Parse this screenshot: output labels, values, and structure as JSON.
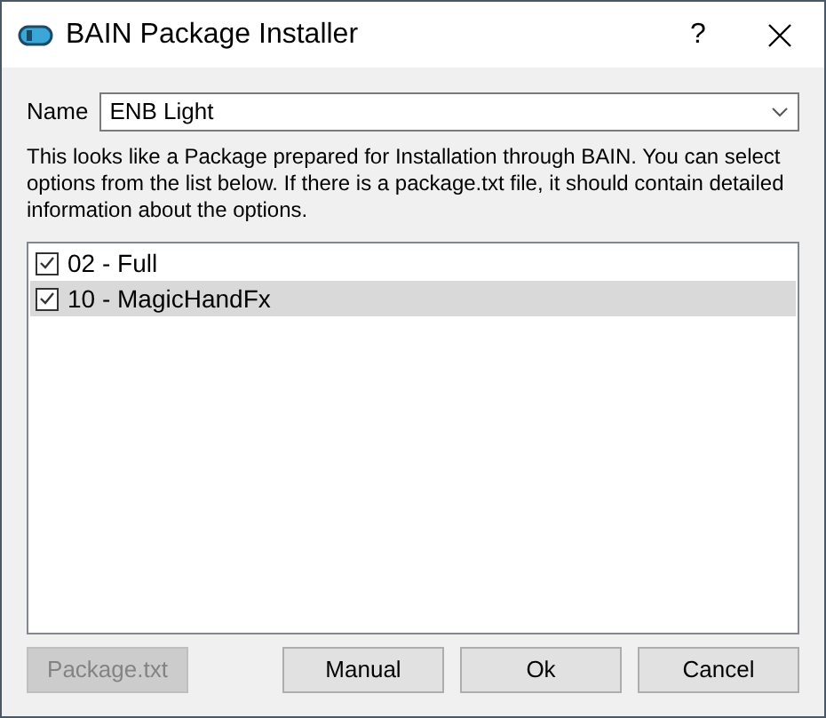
{
  "window": {
    "title": "BAIN Package Installer",
    "help": "?"
  },
  "name_field": {
    "label": "Name",
    "value": "ENB Light"
  },
  "description": "This looks like a Package prepared for Installation through BAIN. You can select options from the list below. If there is a package.txt file, it should contain detailed information about the options.",
  "options": [
    {
      "label": "02 - Full",
      "checked": true,
      "selected": false
    },
    {
      "label": "10 - MagicHandFx",
      "checked": true,
      "selected": true
    }
  ],
  "buttons": [
    {
      "label": "Package.txt",
      "disabled": true
    },
    {
      "label": "Manual",
      "disabled": false
    },
    {
      "label": "Ok",
      "disabled": false
    },
    {
      "label": "Cancel",
      "disabled": false
    }
  ]
}
